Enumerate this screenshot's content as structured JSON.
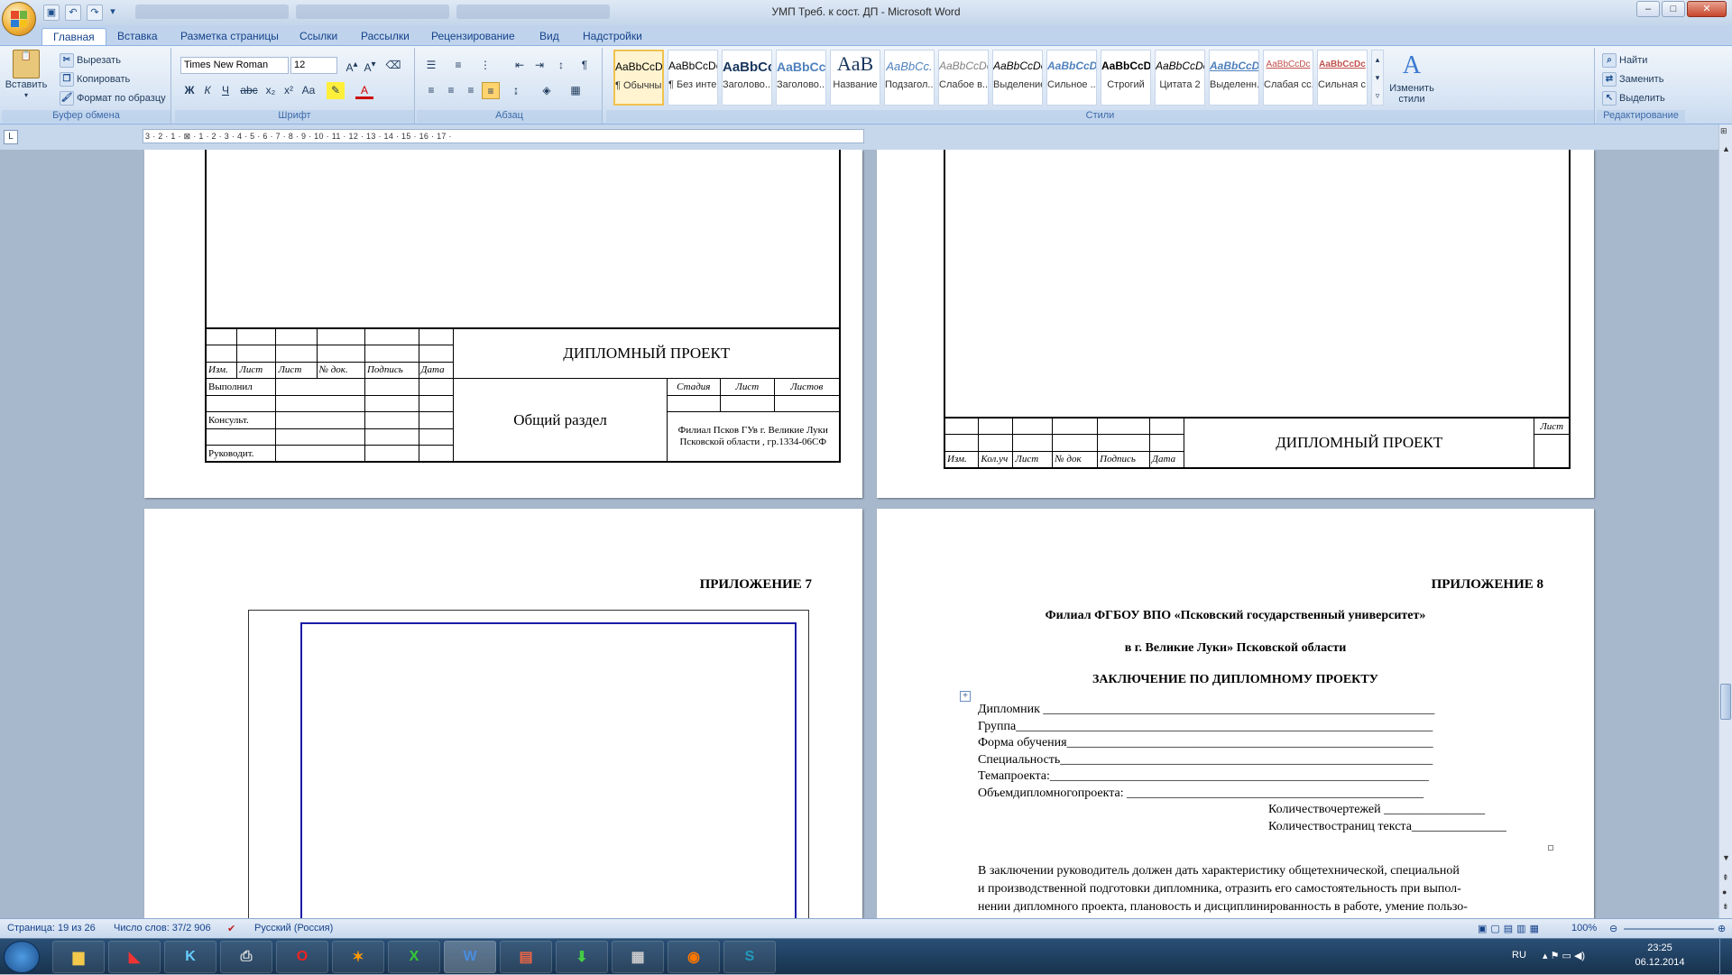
{
  "window": {
    "title": "УМП Треб. к сост. ДП - Microsoft Word",
    "minimize": "–",
    "maximize": "□",
    "close": "✕"
  },
  "tabs": [
    "Главная",
    "Вставка",
    "Разметка страницы",
    "Ссылки",
    "Рассылки",
    "Рецензирование",
    "Вид",
    "Надстройки"
  ],
  "clipboard": {
    "paste": "Вставить",
    "cut": "Вырезать",
    "copy": "Копировать",
    "format_painter": "Формат по образцу",
    "group": "Буфер обмена"
  },
  "font": {
    "name": "Times New Roman",
    "size": "12",
    "group": "Шрифт"
  },
  "paragraph": {
    "group": "Абзац"
  },
  "styles": {
    "group": "Стили",
    "items": [
      {
        "preview": "AaBbCcDc",
        "name": "¶ Обычный"
      },
      {
        "preview": "AaBbCcDc",
        "name": "¶ Без инте..."
      },
      {
        "preview": "AaBbCc",
        "name": "Заголово..."
      },
      {
        "preview": "AaBbCc",
        "name": "Заголово..."
      },
      {
        "preview": "AaB",
        "name": "Название"
      },
      {
        "preview": "AaBbCc.",
        "name": "Подзагол..."
      },
      {
        "preview": "AaBbCcDc",
        "name": "Слабое в..."
      },
      {
        "preview": "AaBbCcDc",
        "name": "Выделение"
      },
      {
        "preview": "AaBbCcDc",
        "name": "Сильное ..."
      },
      {
        "preview": "AaBbCcDc",
        "name": "Строгий"
      },
      {
        "preview": "AaBbCcDc",
        "name": "Цитата 2"
      },
      {
        "preview": "AaBbCcDc",
        "name": "Выделенн..."
      },
      {
        "preview": "AaBbCcDc",
        "name": "Слабая сс..."
      },
      {
        "preview": "AaBbCcDc",
        "name": "Сильная с..."
      }
    ],
    "change": "Изменить стили"
  },
  "editing": {
    "find": "Найти",
    "replace": "Заменить",
    "select": "Выделить",
    "group": "Редактирование"
  },
  "ruler": "3 · 2 · 1 · ⊠ · 1 · 2 · 3 · 4 · 5 · 6 · 7 · 8 · 9 · 10 · 11 · 12 · 13 · 14 · 15 · 16 · 17 ·",
  "ruler_tab": "L",
  "page1": {
    "stamp_title": "ДИПЛОМНЫЙ ПРОЕКТ",
    "col_headers": [
      "Изм.",
      "Лист",
      "Лист",
      "№ док.",
      "Подпись",
      "Дата"
    ],
    "roles": [
      "Выполнил",
      "Консульт.",
      "Руководит."
    ],
    "section": "Общий раздел",
    "stage_headers": [
      "Стадия",
      "Лист",
      "Листов"
    ],
    "org": "Филиал Псков ГУв г. Великие Луки Псковской области , гр.1334-06СФ"
  },
  "page2": {
    "stamp_title": "ДИПЛОМНЫЙ ПРОЕКТ",
    "col_headers": [
      "Изм.",
      "Кол.уч",
      "Лист",
      "№ док",
      "Подпись",
      "Дата"
    ],
    "sheet": "Лист"
  },
  "page3": {
    "appendix": "ПРИЛОЖЕНИЕ 7"
  },
  "page4": {
    "appendix": "ПРИЛОЖЕНИЕ 8",
    "org1": "Филиал ФГБОУ ВПО «Псковский государственный университет»",
    "org2": "в г. Великие Луки» Псковской области",
    "heading": "ЗАКЛЮЧЕНИЕ ПО ДИПЛОМНОМУ  ПРОЕКТУ",
    "fields": [
      "Дипломник ______________________________________________________________",
      "Группа__________________________________________________________________",
      "Форма обучения__________________________________________________________",
      "Специальность___________________________________________________________",
      "Темапроекта:____________________________________________________________",
      "Объемдипломногопроекта:  _______________________________________________"
    ],
    "drawings": "Количествочертежей  ________________",
    "pages": "Количествостраниц текста_______________",
    "body": [
      "В заключении руководитель должен дать характеристику общетехнической, специальной",
      "и производственной подготовки дипломника, отразить его самостоятельность при выпол-",
      "нении дипломного проекта, плановость и дисциплинированность в работе, умение пользо-"
    ]
  },
  "status": {
    "page": "Страница: 19 из 26",
    "words": "Число слов: 37/2 906",
    "lang": "Русский (Россия)",
    "zoom": "100%"
  },
  "tray": {
    "lang": "RU",
    "time": "23:25",
    "date": "06.12.2014"
  }
}
